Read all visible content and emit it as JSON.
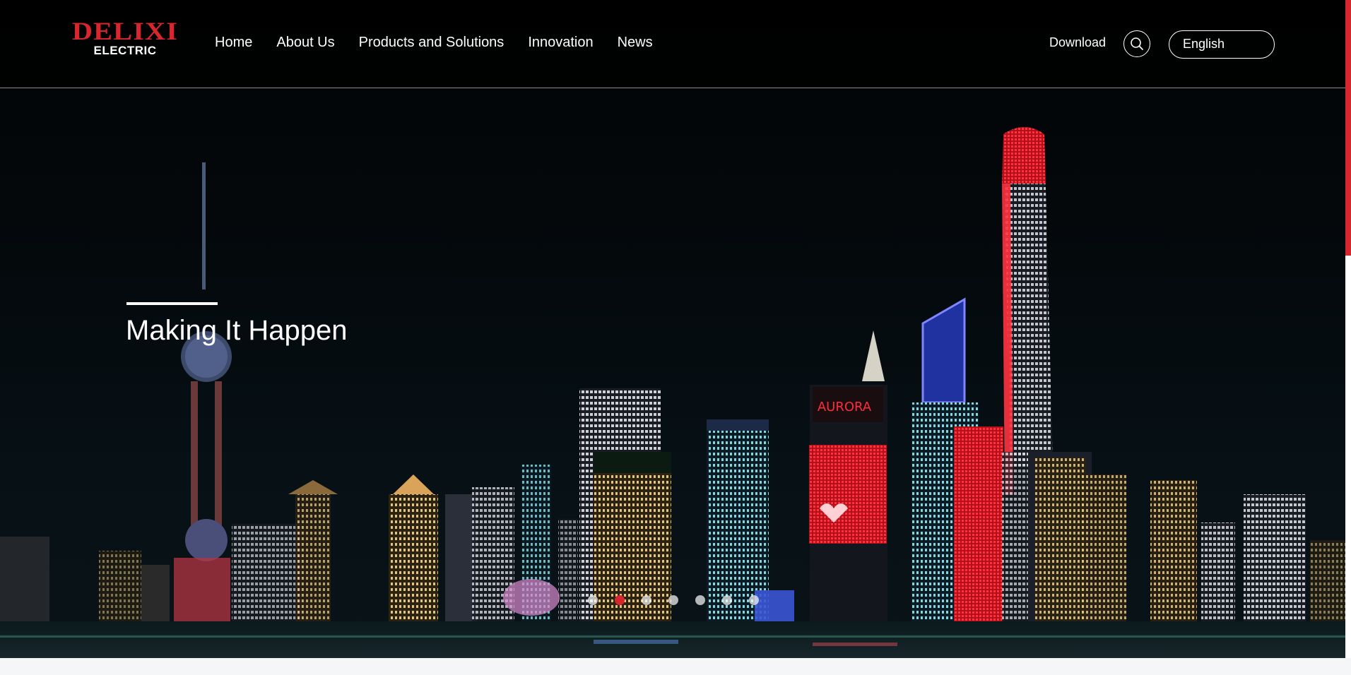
{
  "brand": {
    "logo_main": "DELIXI",
    "logo_sub": "ELECTRIC",
    "accent_color": "#d8262f"
  },
  "nav": {
    "items": [
      {
        "label": "Home"
      },
      {
        "label": "About Us"
      },
      {
        "label": "Products and Solutions"
      },
      {
        "label": "Innovation"
      },
      {
        "label": "News"
      }
    ]
  },
  "header": {
    "download_label": "Download",
    "search_icon": "search-icon",
    "language_selected": "English"
  },
  "hero": {
    "title": "Making It Happen",
    "background": "night-city-skyline-photo"
  },
  "carousel": {
    "slide_count": 7,
    "active_index": 2
  }
}
